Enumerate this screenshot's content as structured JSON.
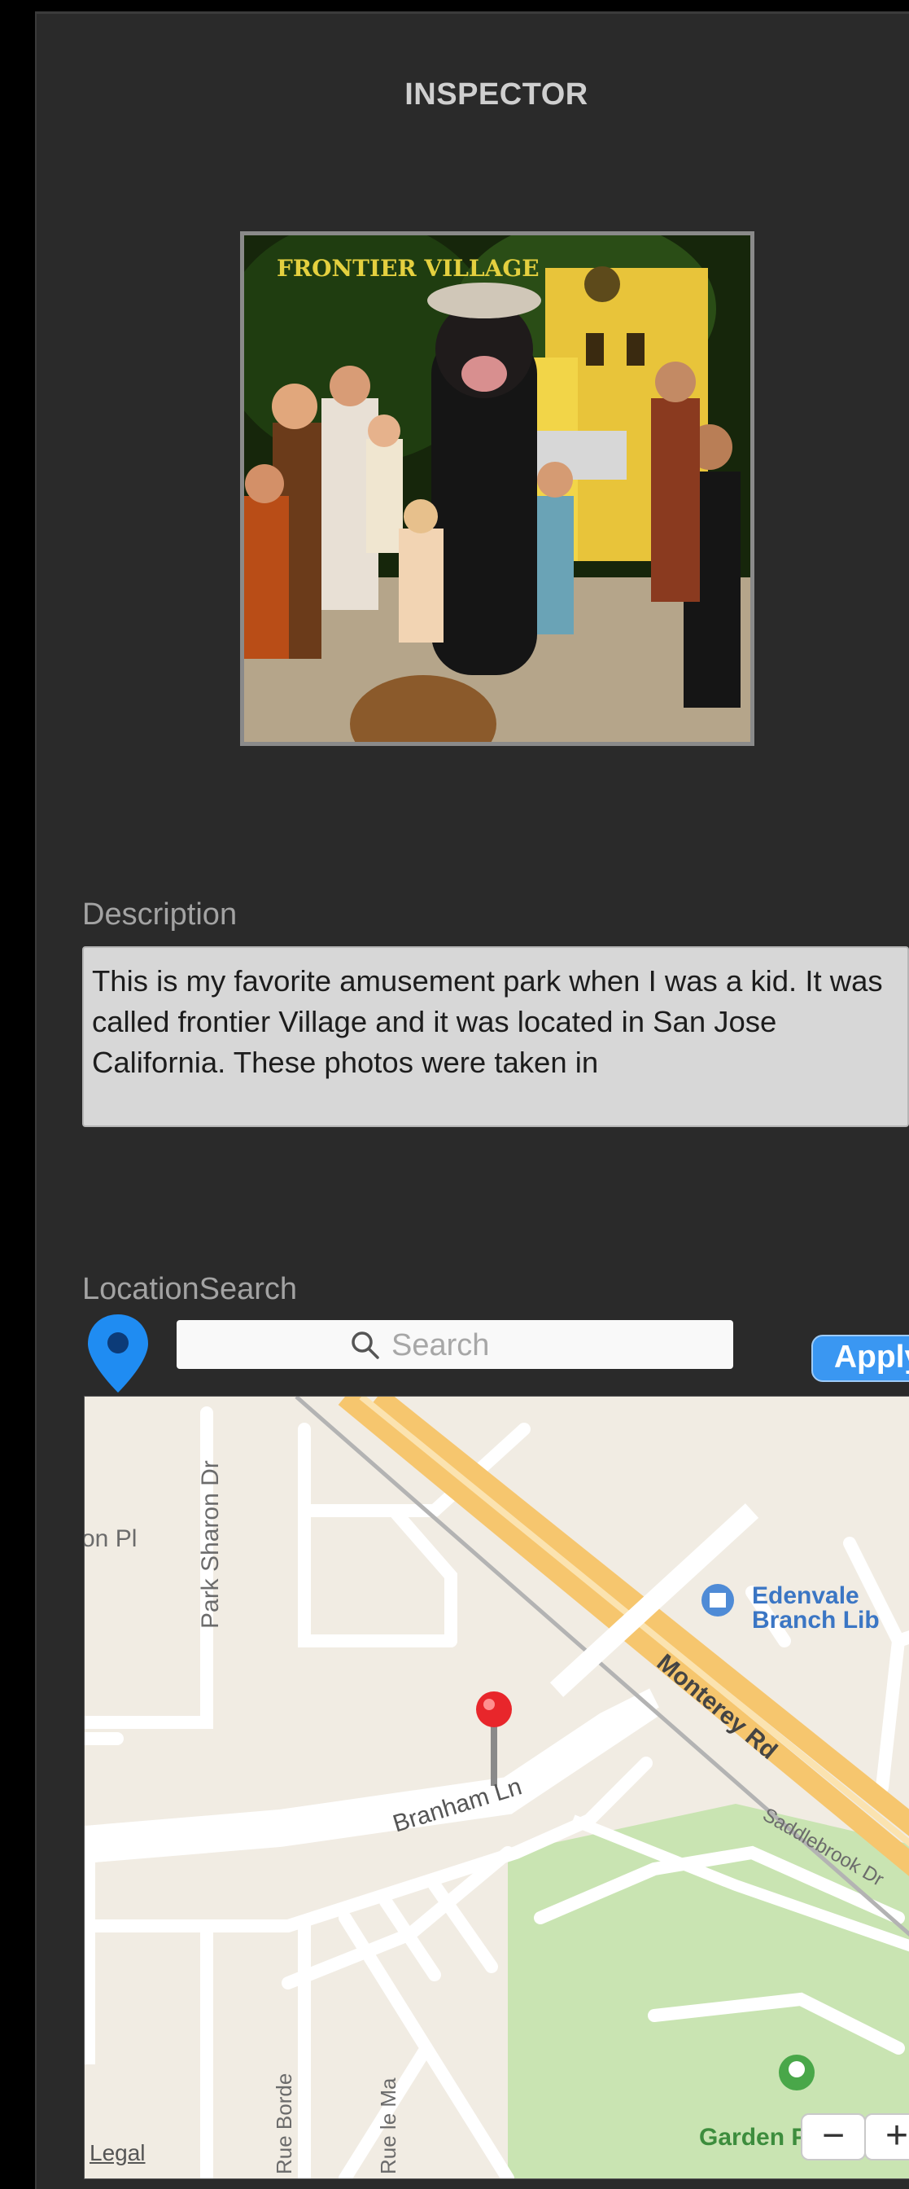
{
  "inspector": {
    "title": "INSPECTOR"
  },
  "photo": {
    "sign_text": "FRONTIER VILLAGE"
  },
  "description": {
    "label": "Description",
    "text": "This is my favorite amusement park when I was a kid. It was called frontier Village and it was located in San Jose California. These photos were taken in"
  },
  "location": {
    "label": "LocationSearch",
    "pin_icon": "location-pin-icon",
    "search_icon": "search-icon",
    "search_placeholder": "Search",
    "apply_label": "Apply"
  },
  "map": {
    "labels": {
      "on_pl": "on Pl",
      "park_sharon": "Park Sharon Dr",
      "edenvale_1": "Edenvale",
      "edenvale_2": "Branch Lib",
      "monterey": "Monterey Rd",
      "branham": "Branham Ln",
      "saddlebrook": "Saddlebrook Dr",
      "rue_borde": "Rue Borde",
      "rue_le_ma": "Rue le Ma",
      "garden_park": "Garden Park"
    },
    "legal": "Legal",
    "zoom_out": "−",
    "zoom_in": "+",
    "colors": {
      "background": "#f1ece3",
      "highway": "#f6c66e",
      "park": "#c9e4b2",
      "pin": "#e8262b"
    }
  }
}
